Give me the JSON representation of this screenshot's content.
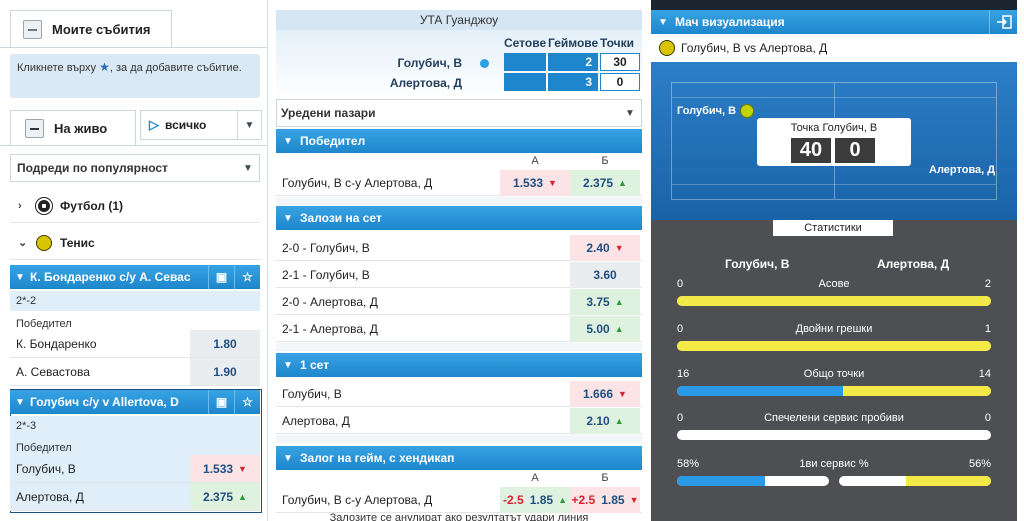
{
  "left": {
    "my_events_tab": "Моите събития",
    "hint_before": "Кликнете върху",
    "hint_after": ", за да добавите събитие.",
    "live_tab": "На живо",
    "all_select": "всичко",
    "sort_select": "Подреди по популярност",
    "sports": [
      {
        "label": "Футбол (1)"
      },
      {
        "label": "Тенис"
      }
    ],
    "events": [
      {
        "title": "К. Бондаренко с/у А. Севас",
        "score": "2*-2",
        "market": "Победител",
        "rows": [
          {
            "name": "К. Бондаренко",
            "odds": "1.80"
          },
          {
            "name": "А. Севастова",
            "odds": "1.90"
          }
        ]
      },
      {
        "title": "Голубич с/у v Allertova, D",
        "score": "2*-3",
        "market": "Победител",
        "rows": [
          {
            "name": "Голубич, В",
            "odds": "1.533"
          },
          {
            "name": "Алертова, Д",
            "odds": "2.375"
          }
        ]
      }
    ]
  },
  "mid": {
    "tournament": "УТА Гуанджоу",
    "cols": [
      "Сетове",
      "Геймове",
      "Точки"
    ],
    "p1": {
      "name": "Голубич, В",
      "games": "2",
      "points": "30"
    },
    "p2": {
      "name": "Алертова, Д",
      "games": "3",
      "points": "0"
    },
    "markets_select": "Уредени пазари",
    "winner": {
      "title": "Победител",
      "col_a": "А",
      "col_b": "Б",
      "row_name": "Голубич, В с-у Алертова, Д",
      "a": "1.533",
      "b": "2.375"
    },
    "set_bets": {
      "title": "Залози на сет",
      "rows": [
        {
          "name": "2-0 - Голубич, В",
          "odds": "2.40"
        },
        {
          "name": "2-1 - Голубич, В",
          "odds": "3.60"
        },
        {
          "name": "2-0 - Алертова, Д",
          "odds": "3.75"
        },
        {
          "name": "2-1 - Алертова, Д",
          "odds": "5.00"
        }
      ]
    },
    "set1": {
      "title": "1 сет",
      "rows": [
        {
          "name": "Голубич, В",
          "odds": "1.666"
        },
        {
          "name": "Алертова, Д",
          "odds": "2.10"
        }
      ]
    },
    "handicap": {
      "title": "Залог на гейм, с хендикап",
      "col_a": "А",
      "col_b": "Б",
      "row_name": "Голубич, В с-у Алертова, Д",
      "a_hcp": "-2.5",
      "a": "1.85",
      "b_hcp": "+2.5",
      "b": "1.85"
    },
    "footnote": "Залозите се анулират ако резултатът удари линия"
  },
  "right": {
    "title": "Мач визуализация",
    "match": "Голубич, В vs Алертова, Д",
    "p1": "Голубич, В",
    "p2": "Алертова, Д",
    "point_label": "Точка Голубич, В",
    "score_left": "40",
    "score_right": "0",
    "stats_button": "Статистики",
    "stats": [
      {
        "label": "Асове",
        "left": "0",
        "right": "2",
        "left_frac": 0,
        "right_frac": 1
      },
      {
        "label": "Двойни грешки",
        "left": "0",
        "right": "1",
        "left_frac": 0,
        "right_frac": 1
      },
      {
        "label": "Общо точки",
        "left": "16",
        "right": "14",
        "left_frac": 0.53,
        "right_frac": 0.47
      },
      {
        "label": "Спечелени сервис пробиви",
        "left": "0",
        "right": "0",
        "left_frac": 0,
        "right_frac": 0
      }
    ],
    "first_serve": {
      "label": "1ви сервис %",
      "left": "58%",
      "right": "56%",
      "left_frac": 0.58,
      "right_frac": 0.56
    }
  },
  "colors": {
    "accent": "#1e86cc",
    "odds_down": "#d8232f",
    "odds_up": "#2f9b3b",
    "stat_yellow": "#f3ea47",
    "stat_blue": "#2a9ae6"
  }
}
